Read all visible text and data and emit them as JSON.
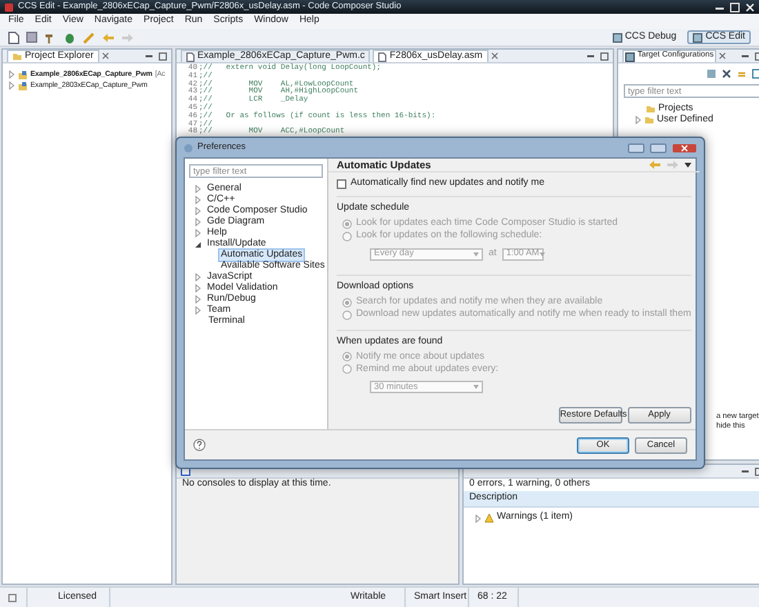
{
  "window": {
    "title": "CCS Edit - Example_2806xECap_Capture_Pwm/F2806x_usDelay.asm - Code Composer Studio"
  },
  "menu": [
    "File",
    "Edit",
    "View",
    "Navigate",
    "Project",
    "Run",
    "Scripts",
    "Window",
    "Help"
  ],
  "perspectives": [
    {
      "label": "CCS Debug",
      "selected": false
    },
    {
      "label": "CCS Edit",
      "selected": true
    }
  ],
  "project_explorer": {
    "title": "Project Explorer",
    "projects": [
      {
        "name": "Example_2806xECap_Capture_Pwm",
        "tag": "[Ac",
        "active": true
      },
      {
        "name": "Example_2803xECap_Capture_Pwm",
        "active": false
      }
    ]
  },
  "editor": {
    "tabs": [
      {
        "label": "Example_2806xECap_Capture_Pwm.c",
        "selected": false
      },
      {
        "label": "F2806x_usDelay.asm",
        "selected": true
      }
    ],
    "lines": [
      {
        "number": "40",
        "code": ";//   extern void Delay(long LoopCount);"
      },
      {
        "number": "41",
        "code": ";//"
      },
      {
        "number": "42",
        "code": ";//        MOV    AL,#LowLoopCount"
      },
      {
        "number": "43",
        "code": ";//        MOV    AH,#HighLoopCount"
      },
      {
        "number": "44",
        "code": ";//        LCR    _Delay"
      },
      {
        "number": "45",
        "code": ";//"
      },
      {
        "number": "46",
        "code": ";//   Or as follows (if count is less then 16-bits):"
      },
      {
        "number": "47",
        "code": ";//"
      },
      {
        "number": "48",
        "code": ";//        MOV    ACC,#LoopCount"
      }
    ]
  },
  "target_configurations": {
    "title": "Target Configurations",
    "filter": {
      "placeholder": "type filter text"
    },
    "items": [
      {
        "label": "Projects",
        "kind": "leaf"
      },
      {
        "label": "User Defined",
        "kind": "branch",
        "expanded": false
      }
    ],
    "hint_lines": [
      "a new target",
      "hide this"
    ]
  },
  "console": {
    "message": "No consoles to display at this time."
  },
  "problems": {
    "summary": "0 errors, 1 warning, 0 others",
    "columns": [
      "Description"
    ],
    "rows": [
      {
        "label": "Warnings (1 item)"
      }
    ]
  },
  "status_bar": [
    "Licensed",
    "Writable",
    "Smart Insert",
    "68 : 22"
  ],
  "dialog": {
    "title": "Preferences",
    "filter": {
      "placeholder": "type filter text"
    },
    "tree": [
      {
        "label": "General",
        "kind": "branch",
        "expanded": false,
        "selected": false
      },
      {
        "label": "C/C++",
        "kind": "branch",
        "expanded": false,
        "selected": false
      },
      {
        "label": "Code Composer Studio",
        "kind": "branch",
        "expanded": false,
        "selected": false
      },
      {
        "label": "Gde Diagram",
        "kind": "branch",
        "expanded": false,
        "selected": false
      },
      {
        "label": "Help",
        "kind": "branch",
        "expanded": false,
        "selected": false
      },
      {
        "label": "Install/Update",
        "kind": "branch",
        "expanded": true,
        "selected": false,
        "children": [
          {
            "label": "Automatic Updates",
            "kind": "leaf",
            "selected": true
          },
          {
            "label": "Available Software Sites",
            "kind": "leaf",
            "selected": false
          }
        ]
      },
      {
        "label": "JavaScript",
        "kind": "branch",
        "expanded": false,
        "selected": false
      },
      {
        "label": "Model Validation",
        "kind": "branch",
        "expanded": false,
        "selected": false
      },
      {
        "label": "Run/Debug",
        "kind": "branch",
        "expanded": false,
        "selected": false
      },
      {
        "label": "Team",
        "kind": "branch",
        "expanded": false,
        "selected": false
      },
      {
        "label": "Terminal",
        "kind": "leaf",
        "selected": false
      }
    ],
    "page": {
      "heading": "Automatic Updates",
      "auto_find": {
        "label": "Automatically find new updates and notify me",
        "checked": false
      },
      "groups": [
        {
          "title": "Update schedule",
          "options": [
            {
              "kind": "radio",
              "label": "Look for updates each time Code Composer Studio is started",
              "selected": true,
              "disabled": true
            },
            {
              "kind": "radio",
              "label": "Look for updates on the following schedule:",
              "selected": false,
              "disabled": true
            },
            {
              "kind": "schedule",
              "value": "Every day",
              "at": "at",
              "time": "1:00 AM",
              "disabled": true
            }
          ]
        },
        {
          "title": "Download options",
          "options": [
            {
              "kind": "radio",
              "label": "Search for updates and notify me when they are available",
              "selected": true,
              "disabled": true
            },
            {
              "kind": "radio",
              "label": "Download new updates automatically and notify me when ready to install them",
              "selected": false,
              "disabled": true
            }
          ]
        },
        {
          "title": "When updates are found",
          "options": [
            {
              "kind": "radio",
              "label": "Notify me once about updates",
              "selected": true,
              "disabled": true
            },
            {
              "kind": "radio",
              "label": "Remind me about updates every:",
              "selected": false,
              "disabled": true
            },
            {
              "kind": "select",
              "value": "30 minutes",
              "disabled": true
            }
          ]
        }
      ],
      "buttons": [
        {
          "label": "Restore Defaults"
        },
        {
          "label": "Apply"
        }
      ]
    },
    "footer_buttons": [
      {
        "label": "OK",
        "default": true
      },
      {
        "label": "Cancel",
        "default": false
      }
    ]
  }
}
